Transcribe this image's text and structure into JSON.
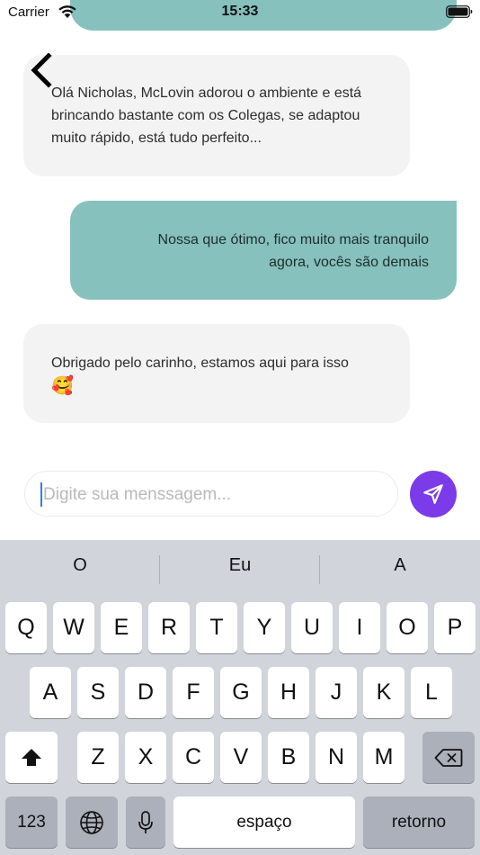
{
  "status_bar": {
    "carrier": "Carrier",
    "time": "15:33"
  },
  "messages": [
    {
      "side": "received",
      "text": "Olá Nicholas, McLovin adorou o ambiente e está brincando bastante com os Colegas, se adaptou muito rápido, está tudo perfeito...",
      "emoji": ""
    },
    {
      "side": "sent",
      "text": "Nossa que ótimo, fico muito mais tranquilo agora, vocês são demais",
      "emoji": ""
    },
    {
      "side": "received",
      "text": "Obrigado pelo carinho, estamos aqui para isso",
      "emoji": "🥰"
    }
  ],
  "composer": {
    "placeholder": "Digite sua menssagem..."
  },
  "keyboard": {
    "suggestions": [
      "O",
      "Eu",
      "A"
    ],
    "row1": [
      "Q",
      "W",
      "E",
      "R",
      "T",
      "Y",
      "U",
      "I",
      "O",
      "P"
    ],
    "row2": [
      "A",
      "S",
      "D",
      "F",
      "G",
      "H",
      "J",
      "K",
      "L"
    ],
    "row3": [
      "Z",
      "X",
      "C",
      "V",
      "B",
      "N",
      "M"
    ],
    "numbers_label": "123",
    "space_label": "espaço",
    "return_label": "retorno"
  },
  "colors": {
    "sent_bubble": "#86c1bd",
    "received_bubble": "#f3f3f3",
    "send_button": "#7b3be8",
    "cursor": "#3478f6"
  },
  "icons": [
    "wifi-icon",
    "battery-icon",
    "back-arrow-icon",
    "send-icon",
    "shift-icon",
    "backspace-icon",
    "globe-icon",
    "microphone-icon"
  ]
}
